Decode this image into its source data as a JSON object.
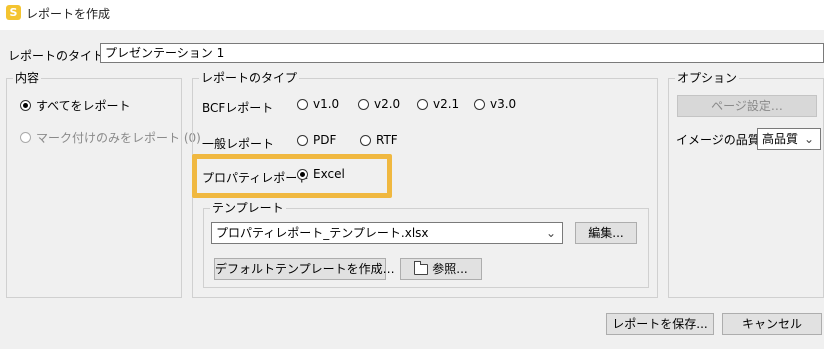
{
  "window": {
    "title": "レポートを作成",
    "app_icon": "S"
  },
  "report_title": {
    "label": "レポートのタイトル",
    "value": "プレゼンテーション 1"
  },
  "content": {
    "legend": "内容",
    "all": "すべてをレポート",
    "marked_only": "マーク付けのみをレポート (0)"
  },
  "report_type": {
    "legend": "レポートのタイプ",
    "bcf_label": "BCFレポート",
    "bcf_options": [
      "v1.0",
      "v2.0",
      "v2.1",
      "v3.0"
    ],
    "general_label": "一般レポート",
    "general_options": [
      "PDF",
      "RTF"
    ],
    "property_label": "プロパティレポート",
    "property_option": "Excel",
    "template_legend": "テンプレート",
    "template_value": "プロパティレポート_テンプレート.xlsx",
    "edit_button": "編集...",
    "default_template_button": "デフォルトテンプレートを作成…",
    "browse_button": "参照..."
  },
  "options": {
    "legend": "オプション",
    "page_setup_button": "ページ設定…",
    "image_quality_label": "イメージの品質",
    "image_quality_value": "高品質"
  },
  "footer": {
    "save_button": "レポートを保存...",
    "cancel_button": "キャンセル"
  },
  "colors": {
    "highlight": "#f0b840",
    "app_icon": "#f4c430"
  }
}
